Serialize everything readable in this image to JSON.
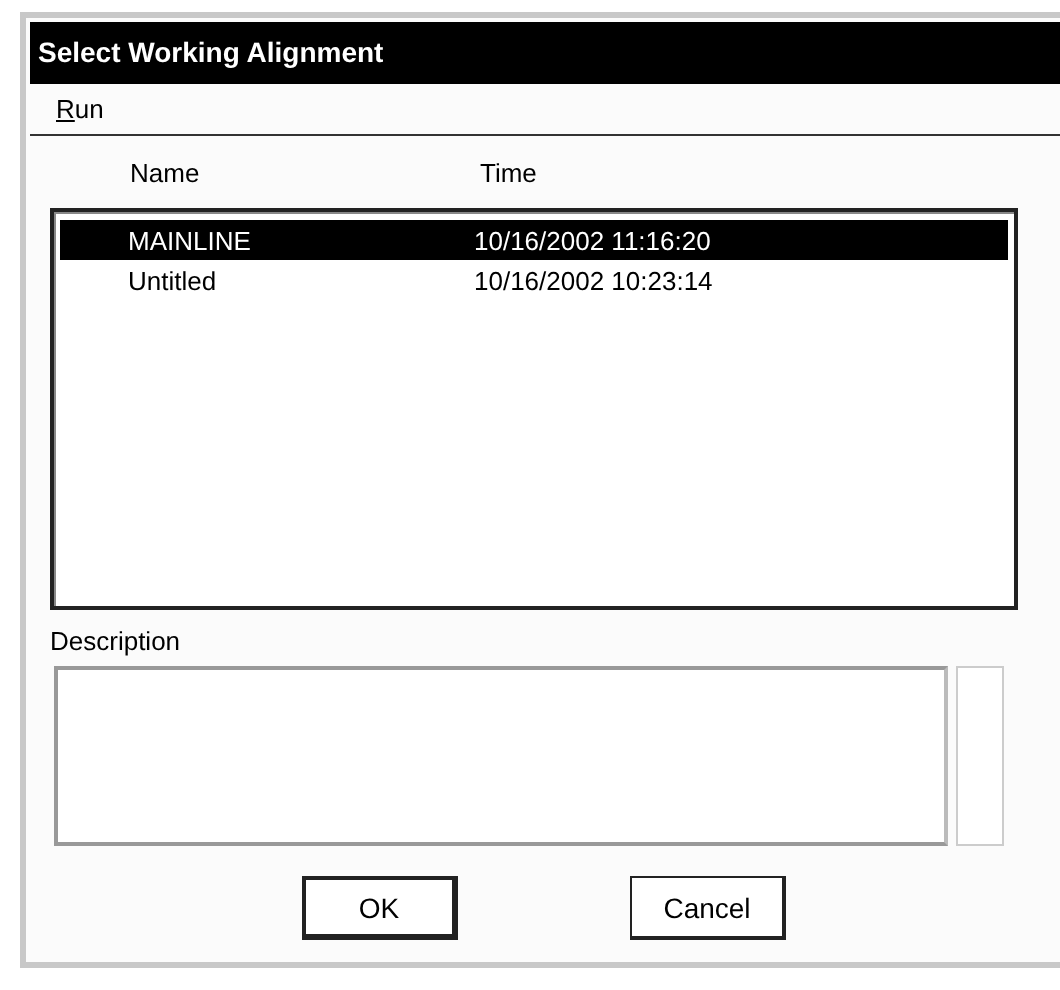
{
  "window": {
    "title": "Select Working Alignment"
  },
  "menu": [
    {
      "label": "Run"
    }
  ],
  "table": {
    "columns": [
      "Name",
      "Time"
    ],
    "rows": [
      {
        "cells": [
          "MAINLINE",
          "10/16/2002 11:16:20"
        ],
        "selected": true
      },
      {
        "cells": [
          "Untitled",
          "10/16/2002 10:23:14"
        ],
        "selected": false
      }
    ]
  },
  "description": {
    "label": "Description"
  },
  "buttons": [
    {
      "label": "OK",
      "default": true
    },
    {
      "label": "Cancel",
      "default": false
    }
  ]
}
